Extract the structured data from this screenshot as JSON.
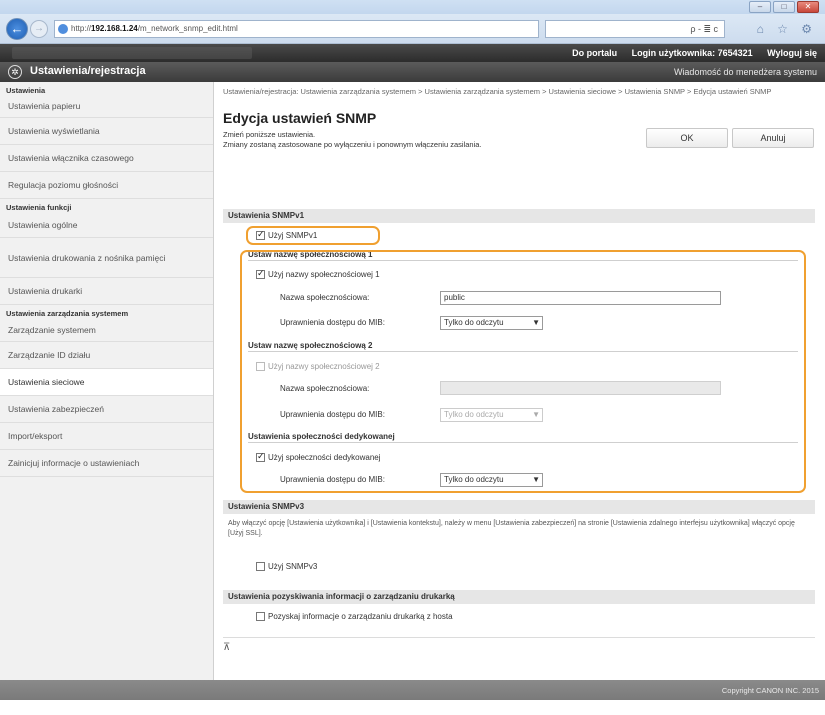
{
  "browser": {
    "url_prefix": "http://",
    "url_host": "192.168.1.24",
    "url_path": "/m_network_snmp_edit.html",
    "address_tools": "ρ - ≣ c",
    "icons": "⌂ ☆ ⚙"
  },
  "header": {
    "portal_link": "Do portalu",
    "login_label": "Login użytkownika: 7654321",
    "logout_link": "Wyloguj się"
  },
  "subheader": {
    "title": "Ustawienia/rejestracja",
    "admin_message": "Wiadomość do menedżera systemu"
  },
  "sidebar": {
    "group1": "Ustawienia",
    "group1_items": [
      "Ustawienia papieru",
      "Ustawienia wyświetlania",
      "Ustawienia włącznika czasowego",
      "Regulacja poziomu głośności"
    ],
    "group2": "Ustawienia funkcji",
    "group2_items": [
      "Ustawienia ogólne",
      "Ustawienia drukowania z nośnika pamięci",
      "Ustawienia drukarki"
    ],
    "group3": "Ustawienia zarządzania systemem",
    "group3_items": [
      "Zarządzanie systemem",
      "Zarządzanie ID działu",
      "Ustawienia sieciowe",
      "Ustawienia zabezpieczeń",
      "Import/eksport",
      "Zainicjuj informacje o ustawieniach"
    ],
    "active": "Ustawienia sieciowe"
  },
  "main": {
    "breadcrumb": "Ustawienia/rejestracja: Ustawienia zarządzania systemem > Ustawienia zarządzania systemem > Ustawienia sieciowe > Ustawienia SNMP > Edycja ustawień SNMP",
    "title": "Edycja ustawień SNMP",
    "intro_line1": "Zmień poniższe ustawienia.",
    "intro_line2": "Zmiany zostaną zastosowane po wyłączeniu i ponownym włączeniu zasilania.",
    "ok_button": "OK",
    "cancel_button": "Anuluj",
    "snmpv1_head": "Ustawienia SNMPv1",
    "use_snmpv1": "Użyj SNMPv1",
    "community1_head": "Ustaw nazwę społecznościową 1",
    "use_community1": "Użyj nazwy społecznościowej 1",
    "community_name_label": "Nazwa społecznościowa:",
    "community1_value": "public",
    "mib_access_label": "Uprawnienia dostępu do MIB:",
    "mib_access_value": "Tylko do odczytu",
    "community2_head": "Ustaw nazwę społecznościową 2",
    "use_community2": "Użyj nazwy społecznościowej 2",
    "community2_value": "",
    "dedicated_head": "Ustawienia społeczności dedykowanej",
    "use_dedicated": "Użyj społeczności dedykowanej",
    "snmpv3_head": "Ustawienia SNMPv3",
    "snmpv3_note": "Aby włączyć opcję [Ustawienia użytkownika] i [Ustawienia kontekstu], należy w menu [Ustawienia zabezpieczeń] na stronie [Ustawienia zdalnego interfejsu użytkownika] włączyć opcję [Użyj SSL].",
    "use_snmpv3": "Użyj SNMPv3",
    "printer_mgmt_head": "Ustawienia pozyskiwania informacji o zarządzaniu drukarką",
    "get_printer_mgmt": "Pozyskaj informacje o zarządzaniu drukarką z hosta",
    "scroll_top": "⊼"
  },
  "footer": {
    "copyright": "Copyright CANON INC. 2015"
  },
  "colors": {
    "highlight": "#f0a030",
    "header_dark": "#2c2c2c",
    "section_gray": "#e6e6e6"
  }
}
